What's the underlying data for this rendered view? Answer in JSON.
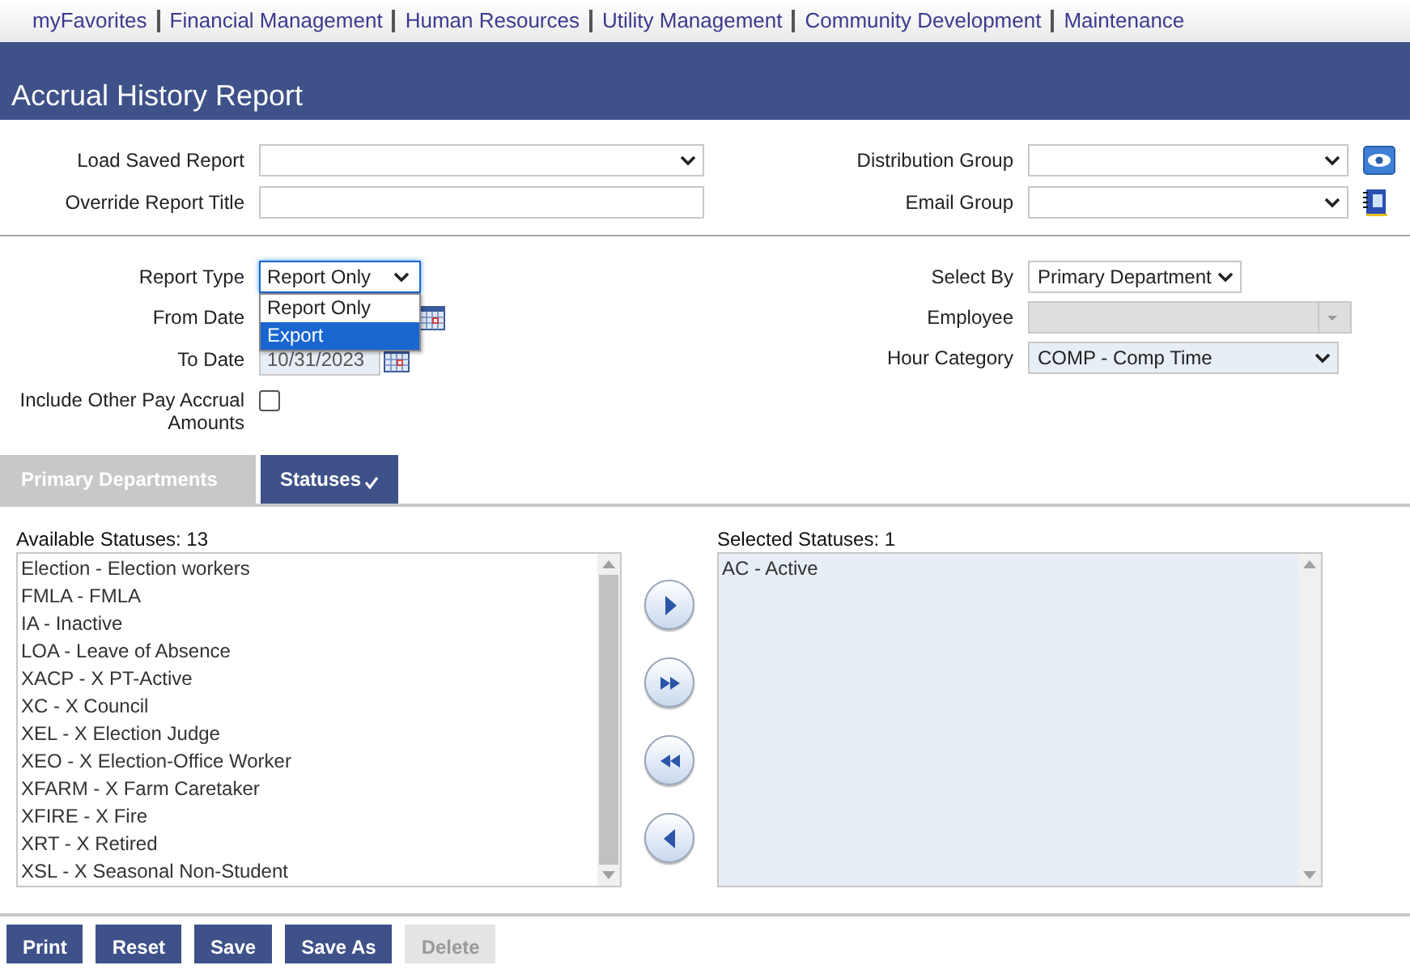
{
  "nav": [
    {
      "label": "myFavorites"
    },
    {
      "label": "Financial Management"
    },
    {
      "label": "Human Resources"
    },
    {
      "label": "Utility Management"
    },
    {
      "label": "Community Development"
    },
    {
      "label": "Maintenance"
    }
  ],
  "title": "Accrual History Report",
  "report_options": {
    "load_saved_report": {
      "label": "Load Saved Report"
    },
    "override_report_title": {
      "label": "Override Report Title"
    },
    "distribution_group": {
      "label": "Distribution Group"
    },
    "email_group": {
      "label": "Email Group"
    }
  },
  "criteria": {
    "report_type": {
      "label": "Report Type",
      "value": "Report Only",
      "expanded": true,
      "options": [
        {
          "label": "Report Only",
          "highlighted": false
        },
        {
          "label": "Export",
          "highlighted": true
        }
      ]
    },
    "from_date": {
      "label": "From Date"
    },
    "to_date": {
      "label": "To Date",
      "value": "10/31/2023"
    },
    "include_other": {
      "label": "Include Other Pay Accrual Amounts",
      "checked": false
    },
    "select_by": {
      "label": "Select By",
      "value": "Primary Department"
    },
    "employee": {
      "label": "Employee",
      "disabled": true
    },
    "hour_category": {
      "label": "Hour Category",
      "value": "COMP - Comp Time"
    }
  },
  "tabs": [
    {
      "label": "Primary Departments",
      "selected": false,
      "checked": false
    },
    {
      "label": "Statuses",
      "selected": true,
      "checked": true
    }
  ],
  "available": {
    "label": "Available Statuses: 13",
    "items": [
      "Election - Election workers",
      "FMLA - FMLA",
      "IA - Inactive",
      "LOA - Leave of Absence",
      "XACP - X PT-Active",
      "XC - X Council",
      "XEL - X Election Judge",
      "XEO - X Election-Office Worker",
      "XFARM - X Farm Caretaker",
      "XFIRE - X Fire",
      "XRT - X Retired",
      "XSL - X Seasonal Non-Student"
    ]
  },
  "selected": {
    "label": "Selected Statuses: 1",
    "items": [
      "AC - Active"
    ]
  },
  "buttons": [
    {
      "label": "Print",
      "disabled": false
    },
    {
      "label": "Reset",
      "disabled": false
    },
    {
      "label": "Save",
      "disabled": false
    },
    {
      "label": "Save As",
      "disabled": false
    },
    {
      "label": "Delete",
      "disabled": true
    }
  ]
}
